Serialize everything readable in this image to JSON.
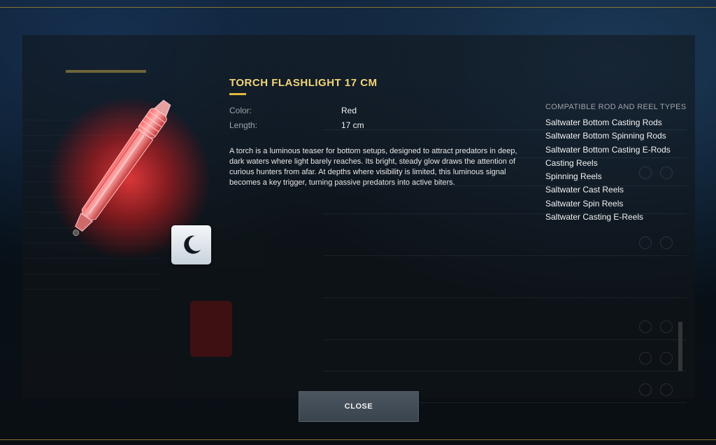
{
  "item": {
    "title": "TORCH FLASHLIGHT 17 CM",
    "attributes": [
      {
        "label": "Color:",
        "value": "Red"
      },
      {
        "label": "Length:",
        "value": "17 cm"
      }
    ],
    "description": "A torch is a luminous teaser for bottom setups, designed to attract predators in deep, dark waters where light barely reaches. Its bright, steady glow draws the attention of curious hunters from afar. At depths where visibility is limited, this luminous signal becomes a key trigger, turning passive predators into active biters.",
    "night_mode_icon": "crescent-moon-icon"
  },
  "compatibility": {
    "title": "COMPATIBLE ROD AND REEL TYPES",
    "items": [
      "Saltwater Bottom Casting Rods",
      "Saltwater Bottom Spinning Rods",
      "Saltwater Bottom Casting E-Rods",
      "Casting Reels",
      "Spinning Reels",
      "Saltwater Cast Reels",
      "Saltwater Spin Reels",
      "Saltwater Casting E-Reels"
    ]
  },
  "actions": {
    "close_label": "CLOSE"
  },
  "colors": {
    "title": "#f3d57a",
    "accent_gold": "#e1b93b",
    "glow_red": "#ff3c3c",
    "button_bg": "#3f4a54"
  }
}
